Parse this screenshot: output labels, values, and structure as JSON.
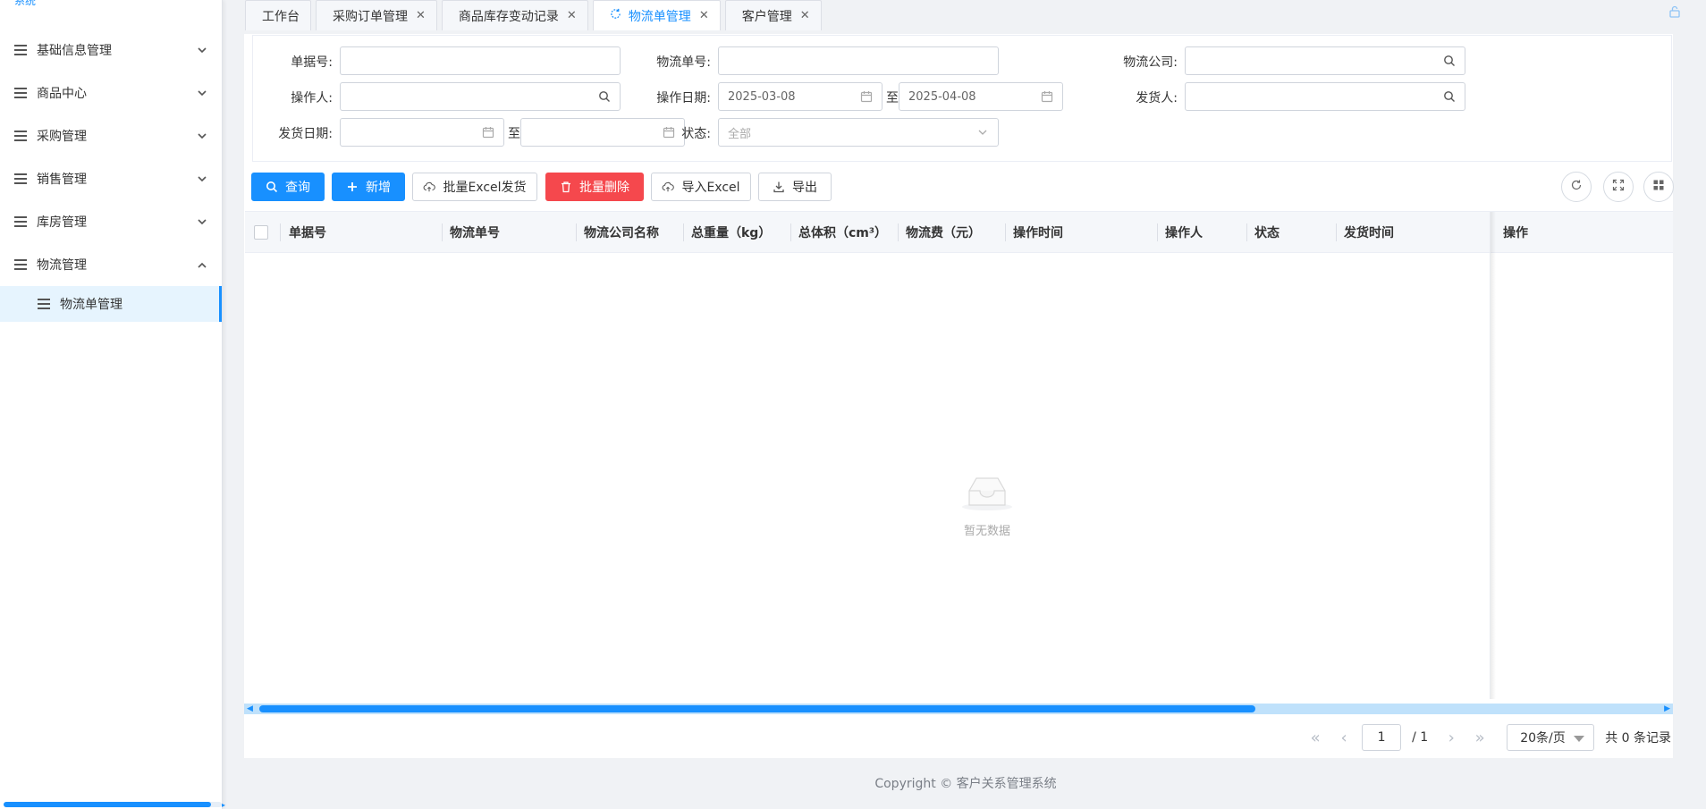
{
  "sidebar": {
    "logo_text": "系统",
    "items": [
      {
        "label": "基础信息管理",
        "expanded": false
      },
      {
        "label": "商品中心",
        "expanded": false
      },
      {
        "label": "采购管理",
        "expanded": false
      },
      {
        "label": "销售管理",
        "expanded": false
      },
      {
        "label": "库房管理",
        "expanded": false
      },
      {
        "label": "物流管理",
        "expanded": true
      }
    ],
    "sub_items": [
      {
        "label": "物流单管理",
        "active": true
      }
    ]
  },
  "tabs": [
    {
      "label": "工作台",
      "closable": false,
      "active": false
    },
    {
      "label": "采购订单管理",
      "closable": true,
      "active": false
    },
    {
      "label": "商品库存变动记录",
      "closable": true,
      "active": false
    },
    {
      "label": "物流单管理",
      "closable": true,
      "active": true
    },
    {
      "label": "客户管理",
      "closable": true,
      "active": false
    }
  ],
  "search": {
    "bill_no_label": "单据号:",
    "bill_no_value": "",
    "logistics_no_label": "物流单号:",
    "logistics_no_value": "",
    "company_label": "物流公司:",
    "company_value": "",
    "operator_label": "操作人:",
    "operator_value": "",
    "op_date_label": "操作日期:",
    "op_date_start": "2025-03-08",
    "op_date_end": "2025-04-08",
    "range_sep": "至",
    "shipper_label": "发货人:",
    "shipper_value": "",
    "ship_date_label": "发货日期:",
    "ship_date_start": "",
    "ship_date_end": "",
    "status_label": "状态:",
    "status_value": "全部"
  },
  "toolbar": {
    "query": "查询",
    "add": "新增",
    "batch_ship": "批量Excel发货",
    "batch_delete": "批量删除",
    "import": "导入Excel",
    "export": "导出"
  },
  "table": {
    "columns": [
      "单据号",
      "物流单号",
      "物流公司名称",
      "总重量（kg）",
      "总体积（cm³）",
      "物流费（元）",
      "操作时间",
      "操作人",
      "状态",
      "发货时间",
      "操作"
    ],
    "rows": [],
    "empty_text": "暂无数据"
  },
  "pager": {
    "current_page": "1",
    "total_pages": "/ 1",
    "page_size": "20条/页",
    "total_text": "共 0 条记录"
  },
  "footer": {
    "text": "Copyright © 客户关系管理系统"
  },
  "colors": {
    "primary": "#1890ff",
    "danger": "#f5484d",
    "active_menu_bg": "#e6f4fe"
  }
}
